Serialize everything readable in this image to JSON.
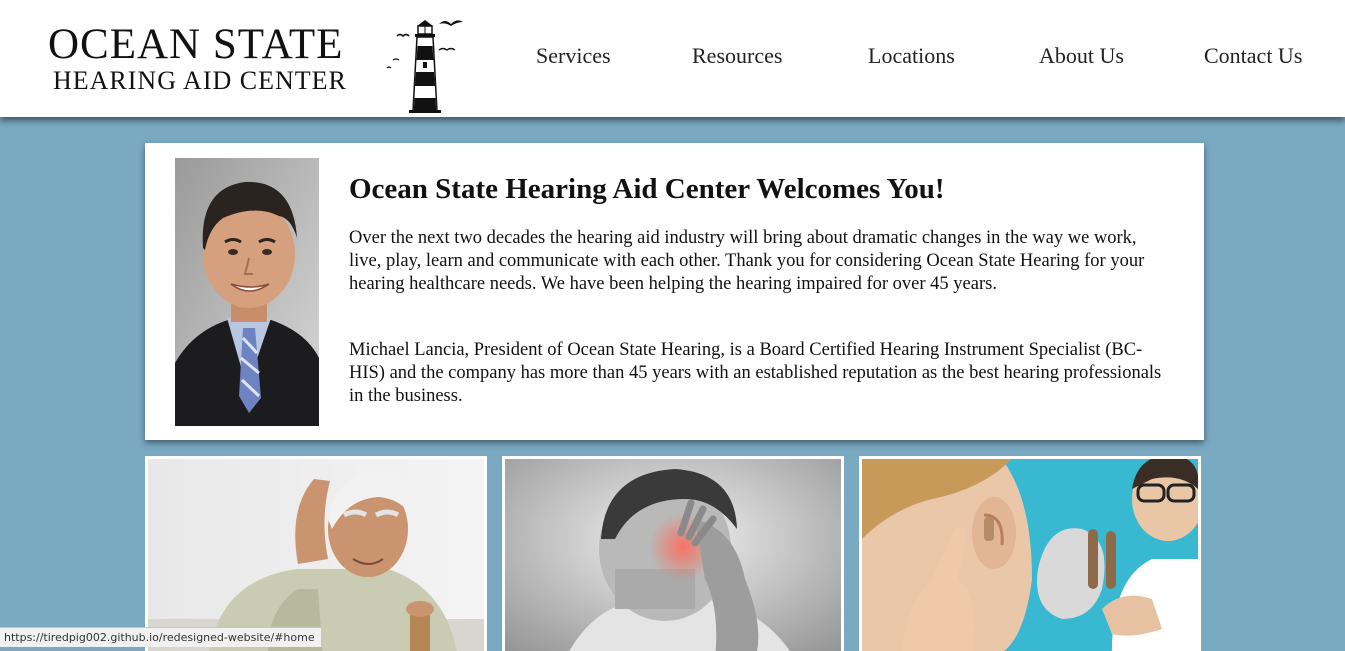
{
  "header": {
    "logo_line1": "OCEAN STATE",
    "logo_line2": "HEARING AID CENTER",
    "nav": [
      "Services",
      "Resources",
      "Locations",
      "About Us",
      "Contact Us"
    ]
  },
  "welcome": {
    "title": "Ocean State Hearing Aid Center Welcomes You!",
    "paragraph1": "Over the next two decades the hearing aid industry will bring about dramatic changes in the way we work, live, play, learn and communicate with each other. Thank you for considering Ocean State Hearing for your hearing healthcare needs. We have been helping the hearing impaired for over 45 years.",
    "paragraph2": "Michael Lancia, President of Ocean State Hearing, is a Board Certified Hearing Instrument Specialist (BC-HIS) and the company has more than 45 years with an established reputation as the best hearing professionals in the business."
  },
  "status_bar": {
    "url": "https://tiredpig002.github.io/redesigned-website/#home"
  },
  "colors": {
    "page_background": "#7aa9c2",
    "header_background": "#ffffff",
    "card_background": "#ffffff"
  }
}
